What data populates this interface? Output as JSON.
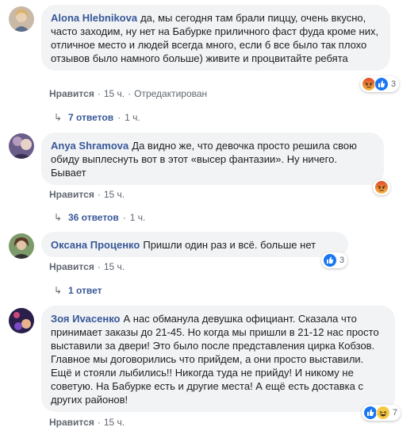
{
  "comments": [
    {
      "author": "Alona Hlebnikova",
      "text": "да, мы сегодня там брали пиццу, очень вкусно, часто заходим, ну нет на Бабурке приличного фаст фуда кроме них, отличное место и людей всегда много, если б все было так плохо отзывов было намного больше) живите и процвитайте ребята",
      "like_label": "Нравится",
      "time": "15 ч.",
      "edited": "Отредактирован",
      "reactions": [
        "angry-icon",
        "like-icon"
      ],
      "reaction_count": "3",
      "replies_label": "7 ответов",
      "replies_time": "1 ч."
    },
    {
      "author": "Anya Shramova",
      "text": "Да видно же, что девочка просто решила свою обиду выплеснуть вот в этот «высер фантазии». Ну ничего. Бывает",
      "like_label": "Нравится",
      "time": "15 ч.",
      "reactions": [
        "angry-icon"
      ],
      "reaction_count": "",
      "replies_label": "36 ответов",
      "replies_time": "1 ч."
    },
    {
      "author": "Оксана Проценко",
      "text": "Пришли один раз и всё. больше нет",
      "like_label": "Нравится",
      "time": "15 ч.",
      "reactions": [
        "like-icon"
      ],
      "reaction_count": "3",
      "replies_label": "1 ответ",
      "replies_time": ""
    },
    {
      "author": "Зоя Иvaсенко",
      "text": "А нас обманула девушка официант. Сказала что принимает заказы до 21-45. Но когда мы пришли в 21-12 нас просто выставили за двери! Это было после представления цирка Кобзов. Главное мы договорились что прийдем, а они просто выставили. Ещё и стояли лыбились!! Никогда туда не прийду! И никому не советую. На Бабурке есть и другие места! А ещё есть доставка с других районов!",
      "like_label": "Нравится",
      "time": "15 ч.",
      "reactions": [
        "like-icon",
        "haha-icon"
      ],
      "reaction_count": "7"
    }
  ],
  "colors": {
    "link": "#385898",
    "bubble": "#f2f3f5",
    "meta": "#606770",
    "like": "#1877f2"
  }
}
